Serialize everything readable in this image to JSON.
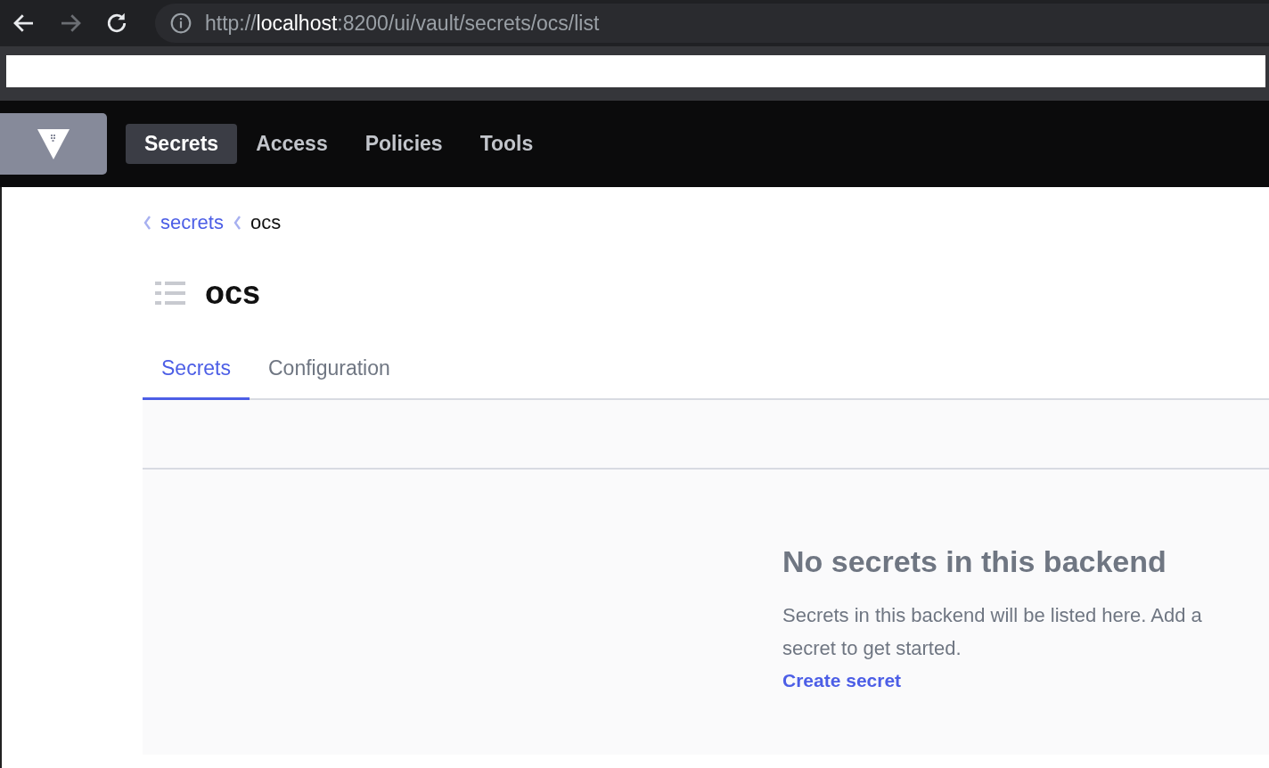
{
  "browser": {
    "url": "http://**localhost**:8200/ui/vault/secrets/ocs/list",
    "back_enabled": true,
    "forward_enabled": false
  },
  "nav": {
    "items": [
      {
        "label": "Secrets",
        "selected": true
      },
      {
        "label": "Access",
        "selected": false
      },
      {
        "label": "Policies",
        "selected": false
      },
      {
        "label": "Tools",
        "selected": false
      }
    ]
  },
  "breadcrumbs": [
    {
      "label": "secrets",
      "link": true
    },
    {
      "label": "ocs",
      "link": false
    }
  ],
  "title": "ocs",
  "tabs": [
    {
      "label": "Secrets",
      "selected": true
    },
    {
      "label": "Configuration",
      "selected": false
    }
  ],
  "empty_state": {
    "title": "No secrets in this backend",
    "message": "Secrets in this backend will be listed here. Add a secret to get started.",
    "action": "Create secret"
  }
}
